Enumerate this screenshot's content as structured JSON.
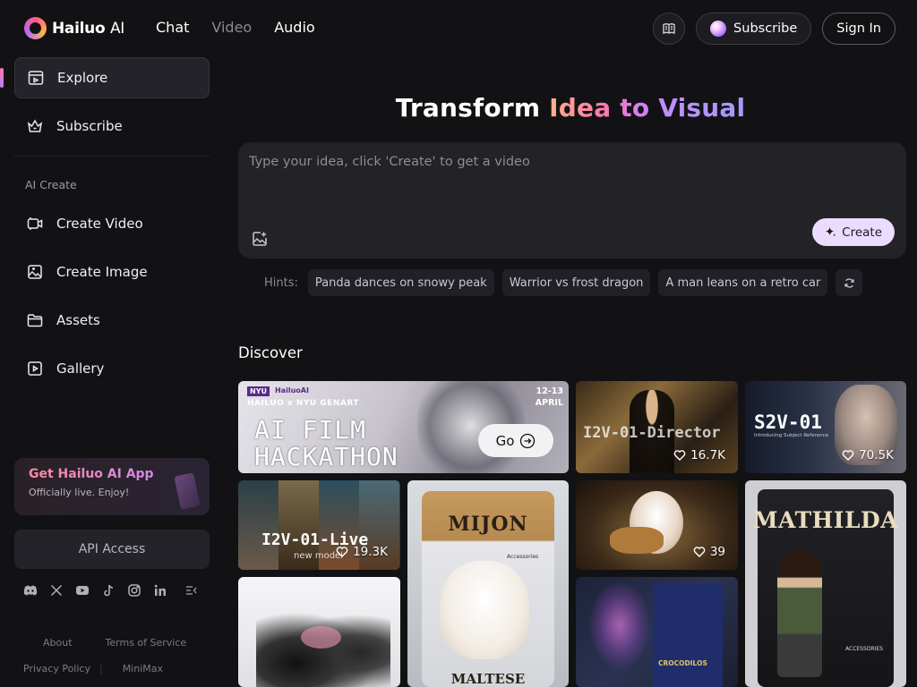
{
  "brand": {
    "name_bold": "Hailuo",
    "name_light": "AI"
  },
  "topnav": {
    "chat": "Chat",
    "video": "Video",
    "audio": "Audio"
  },
  "header": {
    "subscribe": "Subscribe",
    "signin": "Sign In"
  },
  "sidebar": {
    "explore": "Explore",
    "subscribe": "Subscribe",
    "section_title": "AI Create",
    "create_video": "Create Video",
    "create_image": "Create Image",
    "assets": "Assets",
    "gallery": "Gallery",
    "app_card": {
      "title": "Get Hailuo AI App",
      "subtitle": "Officially live. Enjoy!"
    },
    "api_access": "API Access",
    "footer": {
      "about": "About",
      "terms": "Terms of Service",
      "privacy": "Privacy Policy",
      "minimax": "MiniMax"
    }
  },
  "hero": {
    "title_plain": "Transform ",
    "title_grad1": "Idea to",
    "title_grad2": " Visual"
  },
  "prompt": {
    "placeholder": "Type your idea, click 'Create' to get a video",
    "create": "Create"
  },
  "hints": {
    "label": "Hints:",
    "items": [
      "Panda dances on snowy peak",
      "Warrior vs frost dragon",
      "A man leans on a retro car"
    ]
  },
  "discover": {
    "title": "Discover",
    "hackathon": {
      "logos": "NYU",
      "logo2": "HailuoAI",
      "subtitle": "HAILUO x NYU GENART",
      "title_line1": "AI FILM",
      "title_line2": "HACKATHON",
      "date_line1": "12-13",
      "date_line2": "APRIL",
      "go": "Go"
    },
    "cards": {
      "director": {
        "label": "I2V-01-Director",
        "likes": "16.7K"
      },
      "s2v": {
        "label": "S2V-01",
        "sublabel": "Introducing Subject Reference",
        "likes": "70.5K"
      },
      "i2v_live": {
        "label": "I2V-01-Live",
        "sublabel": "new model",
        "likes": "19.3K"
      },
      "mijon": {
        "title": "MIJON",
        "accessories": "Accessories",
        "bottom": "MALTESE"
      },
      "hamster": {
        "likes": "39"
      },
      "mathilda": {
        "title": "MATHILDA",
        "accessories": "ACCESSORIES"
      },
      "croc": {
        "text": "CROCODILOS"
      }
    }
  }
}
